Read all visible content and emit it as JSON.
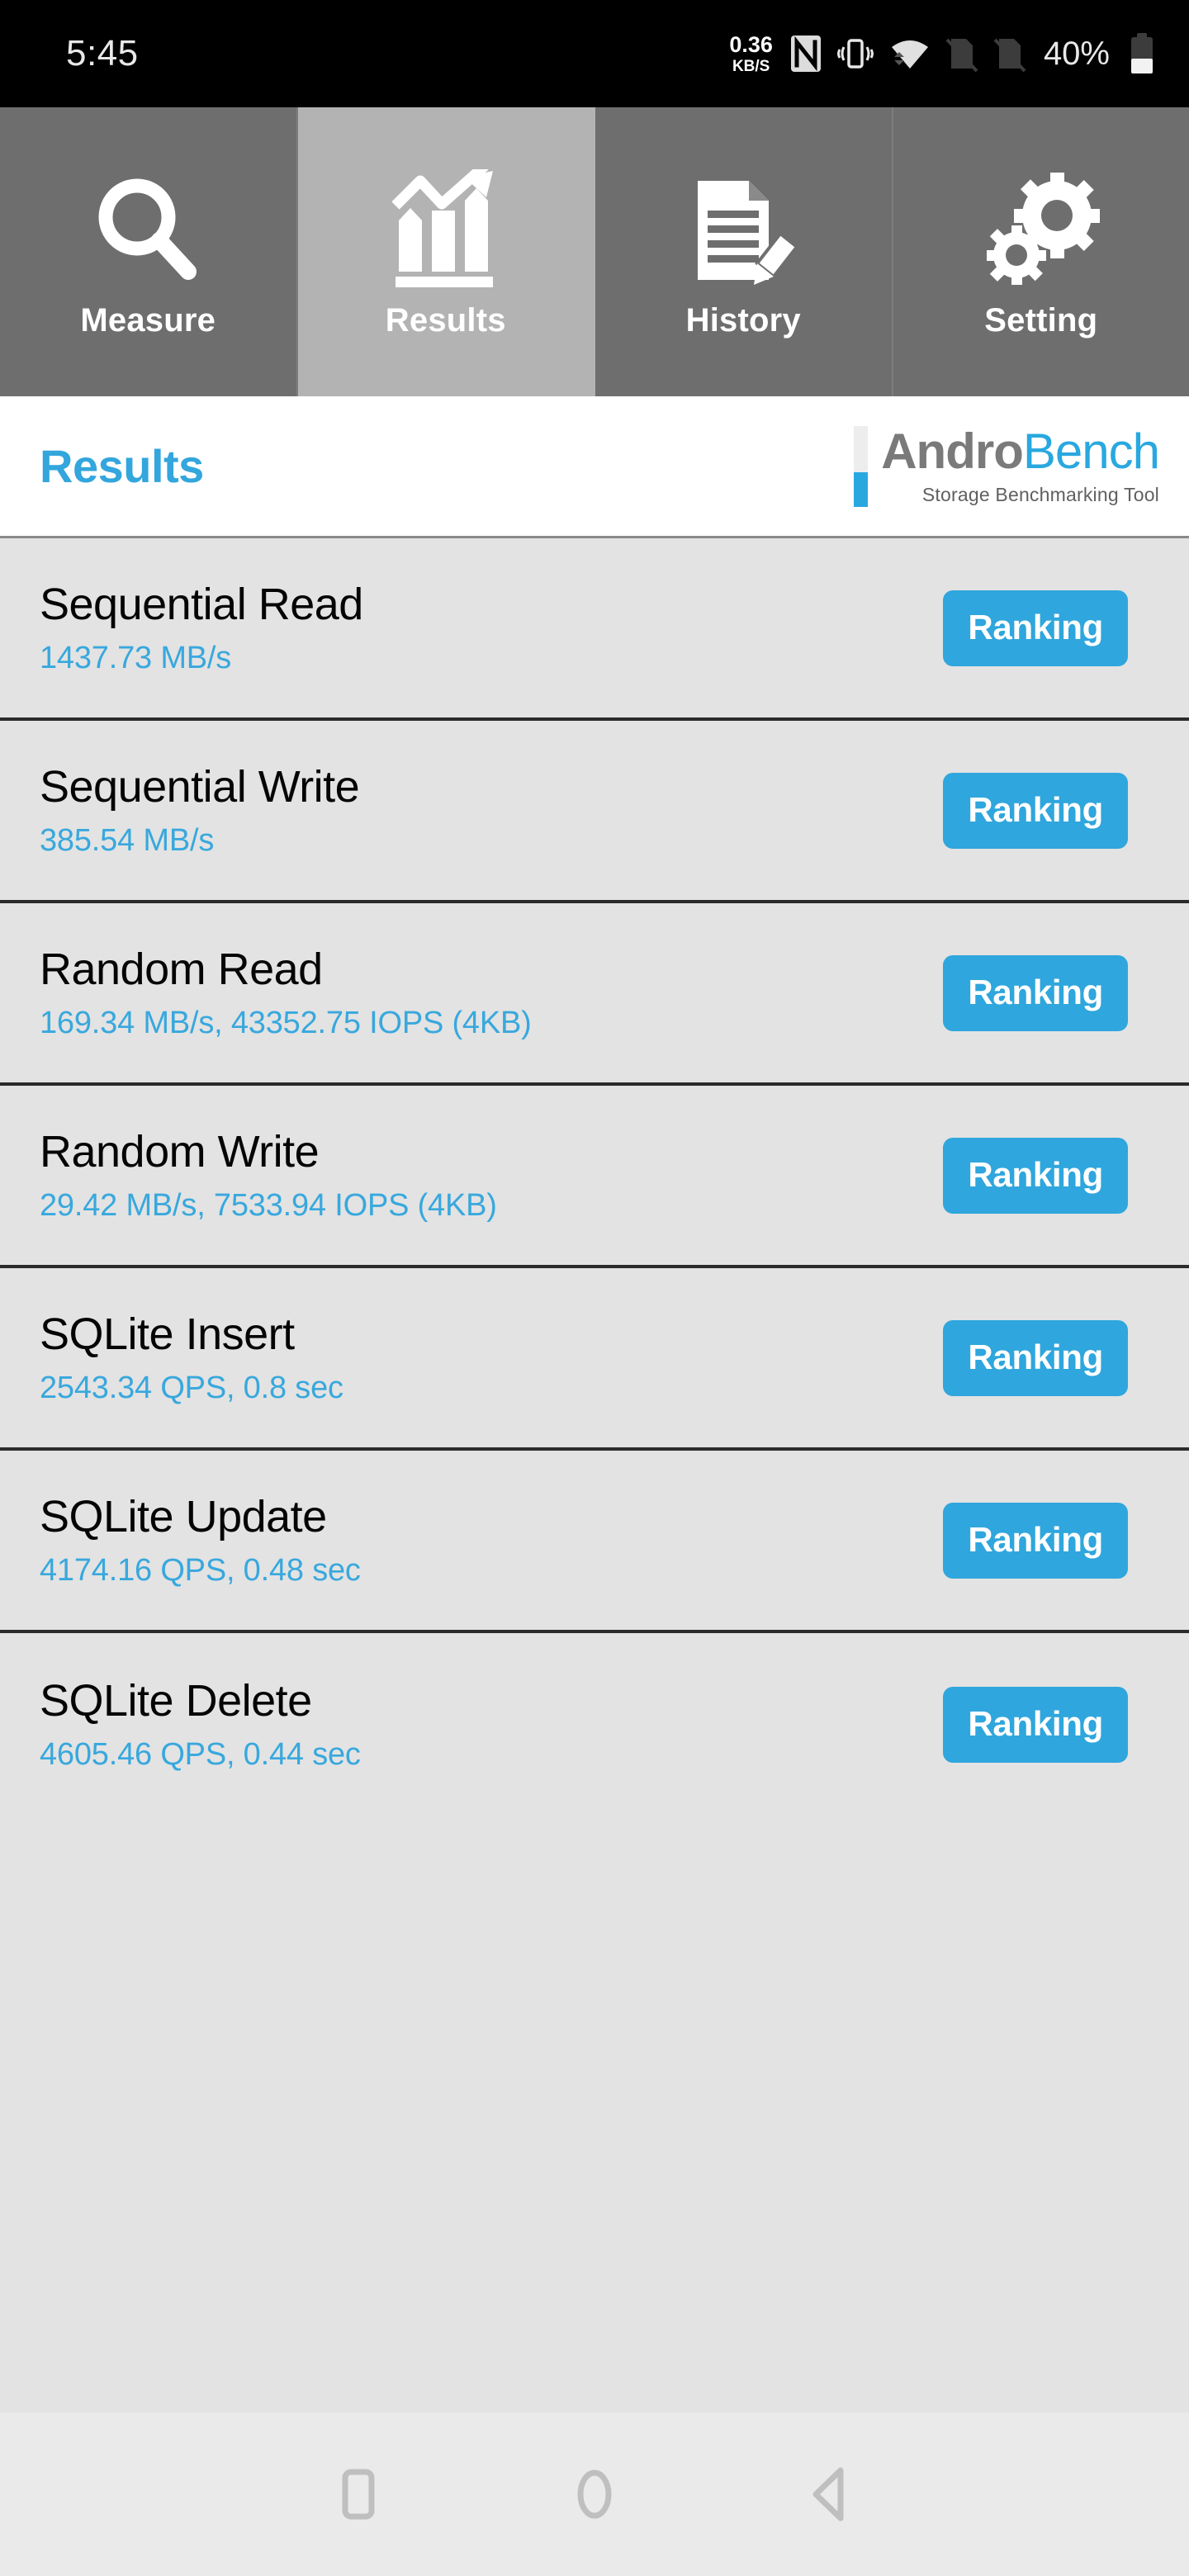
{
  "status_bar": {
    "time": "5:45",
    "net_speed_value": "0.36",
    "net_speed_unit": "KB/S",
    "nfc_icon": "nfc-icon",
    "vibrate_icon": "vibrate-icon",
    "wifi_icon": "wifi-icon",
    "sim1_icon": "sim-card-disabled-icon",
    "sim2_icon": "sim-card-disabled-icon",
    "battery_percent": "40%",
    "battery_icon": "battery-icon"
  },
  "tabs": [
    {
      "label": "Measure",
      "icon": "magnifier-icon",
      "active": false
    },
    {
      "label": "Results",
      "icon": "bar-chart-arrow-icon",
      "active": true
    },
    {
      "label": "History",
      "icon": "document-pencil-icon",
      "active": false
    },
    {
      "label": "Setting",
      "icon": "gears-icon",
      "active": false
    }
  ],
  "header": {
    "page_title": "Results",
    "logo_part1": "Andro",
    "logo_part2": "Bench",
    "logo_subtitle": "Storage Benchmarking Tool"
  },
  "results": {
    "ranking_label": "Ranking",
    "rows": [
      {
        "title": "Sequential Read",
        "value": "1437.73 MB/s"
      },
      {
        "title": "Sequential Write",
        "value": "385.54 MB/s"
      },
      {
        "title": "Random Read",
        "value": "169.34 MB/s, 43352.75 IOPS (4KB)"
      },
      {
        "title": "Random Write",
        "value": "29.42 MB/s, 7533.94 IOPS (4KB)"
      },
      {
        "title": "SQLite Insert",
        "value": "2543.34 QPS, 0.8 sec"
      },
      {
        "title": "SQLite Update",
        "value": "4174.16 QPS, 0.48 sec"
      },
      {
        "title": "SQLite Delete",
        "value": "4605.46 QPS, 0.44 sec"
      }
    ]
  },
  "nav_bar": {
    "recents_icon": "square-recents-icon",
    "home_icon": "circle-home-icon",
    "back_icon": "triangle-back-icon"
  },
  "colors": {
    "accent_blue": "#2fa6dd",
    "title_blue": "#32a6dd",
    "tab_inactive": "#6e6e6e",
    "tab_active": "#b3b3b3",
    "content_bg": "#e3e3e3",
    "nav_bg": "#eaeaea",
    "status_bg": "#000000"
  }
}
